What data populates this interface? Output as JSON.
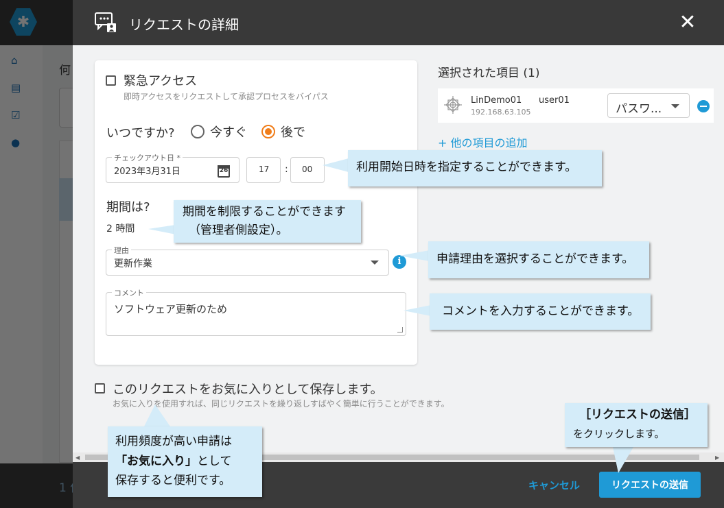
{
  "background": {
    "main_title": "何",
    "bottom_text": "1 件"
  },
  "dialog": {
    "title": "リクエストの詳細",
    "close_label": "✕",
    "urgent": {
      "label": "緊急アクセス",
      "description": "即時アクセスをリクエストして承認プロセスをバイパス",
      "checked": false
    },
    "when": {
      "label": "いつですか?",
      "options": [
        "今すぐ",
        "後で"
      ],
      "selected": "後で"
    },
    "checkout": {
      "legend": "チェックアウト日 *",
      "date": "2023年3月31日",
      "calendar_day": "26",
      "hour": "17",
      "minute": "00"
    },
    "duration": {
      "label": "期間は?",
      "value": "2 時間"
    },
    "reason": {
      "legend": "理由",
      "value": "更新作業"
    },
    "comment": {
      "legend": "コメント",
      "value": "ソフトウェア更新のため"
    },
    "favorite": {
      "label": "このリクエストをお気に入りとして保存します。",
      "description": "お気に入りを使用すれば、同じリクエストを繰り返しすばやく簡単に行うことができます。",
      "checked": false
    },
    "selected": {
      "title": "選択された項目 (1)",
      "items": [
        {
          "name": "LinDemo01",
          "ip": "192.168.63.105",
          "user": "user01",
          "access_type": "パスワ..."
        }
      ],
      "add_more": "+ 他の項目の追加"
    },
    "footer": {
      "cancel_label": "キャンセル",
      "send_label": "リクエストの送信"
    }
  },
  "callouts": {
    "start_time": "利用開始日時を指定することができます。",
    "duration_line1": "期間を制限することができます",
    "duration_line2": "（管理者側設定）。",
    "reason": "申請理由を選択することができます。",
    "comment": "コメントを入力することができます。",
    "favorite_line1": "利用頻度が高い申請は",
    "favorite_bold": "「お気に入り」",
    "favorite_line2_suffix": "として",
    "favorite_line3": "保存すると便利です。",
    "send_bold": "［リクエストの送信］",
    "send_line2": "をクリックします。"
  },
  "colors": {
    "accent": "#1f9ad6",
    "radio_selected": "#f07d1a",
    "header": "#393939",
    "callout_bg": "#d4ecf9"
  }
}
